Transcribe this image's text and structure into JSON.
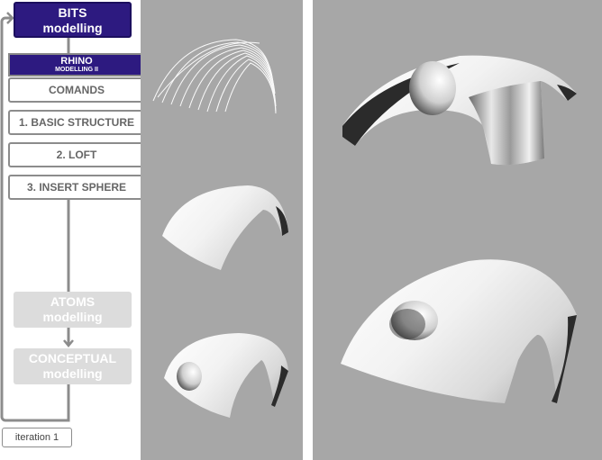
{
  "sidebar": {
    "bits": {
      "line1": "BITS",
      "line2": "modelling"
    },
    "rhino": {
      "title": "RHINO",
      "subtitle": "MODELLING II"
    },
    "steps": [
      "COMANDS",
      "1. BASIC STRUCTURE",
      "2. LOFT",
      "3. INSERT SPHERE"
    ],
    "atoms": {
      "line1": "ATOMS",
      "line2": "modelling"
    },
    "conceptual": {
      "line1": "CONCEPTUAL",
      "line2": "modelling"
    },
    "iteration": "iteration  1"
  },
  "colors": {
    "header_fill": "#2d1a80",
    "panel_bg": "#a7a7a7",
    "inactive_box": "#dcdcdc",
    "connector": "#8c8c8c"
  },
  "icons": [
    "loop-arrow-icon",
    "down-arrow-icon"
  ]
}
